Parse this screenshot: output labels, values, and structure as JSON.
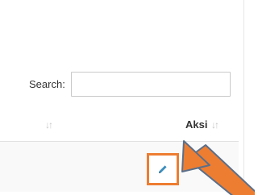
{
  "search": {
    "label": "Search:",
    "value": "",
    "placeholder": ""
  },
  "table": {
    "headers": [
      {
        "label": "",
        "sort_icon": "sort-both-icon"
      },
      {
        "label": "Aksi",
        "sort_icon": "sort-both-icon"
      }
    ],
    "rows": [
      {
        "action_icon": "pencil-icon"
      }
    ]
  },
  "colors": {
    "highlight": "#ed7d31",
    "pencil": "#3c8dbc"
  }
}
